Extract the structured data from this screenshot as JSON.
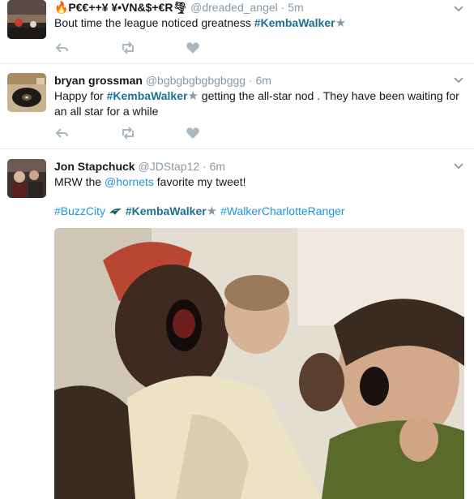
{
  "tweets": [
    {
      "display_name": "🔥P€€++¥ ¥•VN&$+€R🌪",
      "handle": "@dreaded_angel",
      "dot": "·",
      "time": "5m",
      "text_plain": "Bout time the league noticed greatness ",
      "hashtag": "#KembaWalker"
    },
    {
      "display_name": "bryan grossman",
      "handle": "@bgbgbgbgbgbggg",
      "dot": "·",
      "time": "6m",
      "text_prefix": "Happy for ",
      "hashtag": "#KembaWalker",
      "text_suffix": " getting the all-star nod . They have been waiting for an all star for a while"
    },
    {
      "display_name": "Jon Stapchuck",
      "handle": "@JDStap12",
      "dot": "·",
      "time": "6m",
      "text_prefix": "MRW the ",
      "mention": "@hornets",
      "text_suffix": " favorite my tweet!",
      "hashtags": [
        "#BuzzCity",
        "#KembaWalker",
        "#WalkerCharlotteRanger"
      ]
    }
  ],
  "icons": {
    "reply": "reply-icon",
    "retweet": "retweet-icon",
    "like": "heart-icon",
    "more": "chevron-down-icon",
    "star": "star-icon"
  },
  "colors": {
    "hashtag_bold": "#1b6f93",
    "link": "#1b95e0",
    "muted": "#8899a6"
  }
}
